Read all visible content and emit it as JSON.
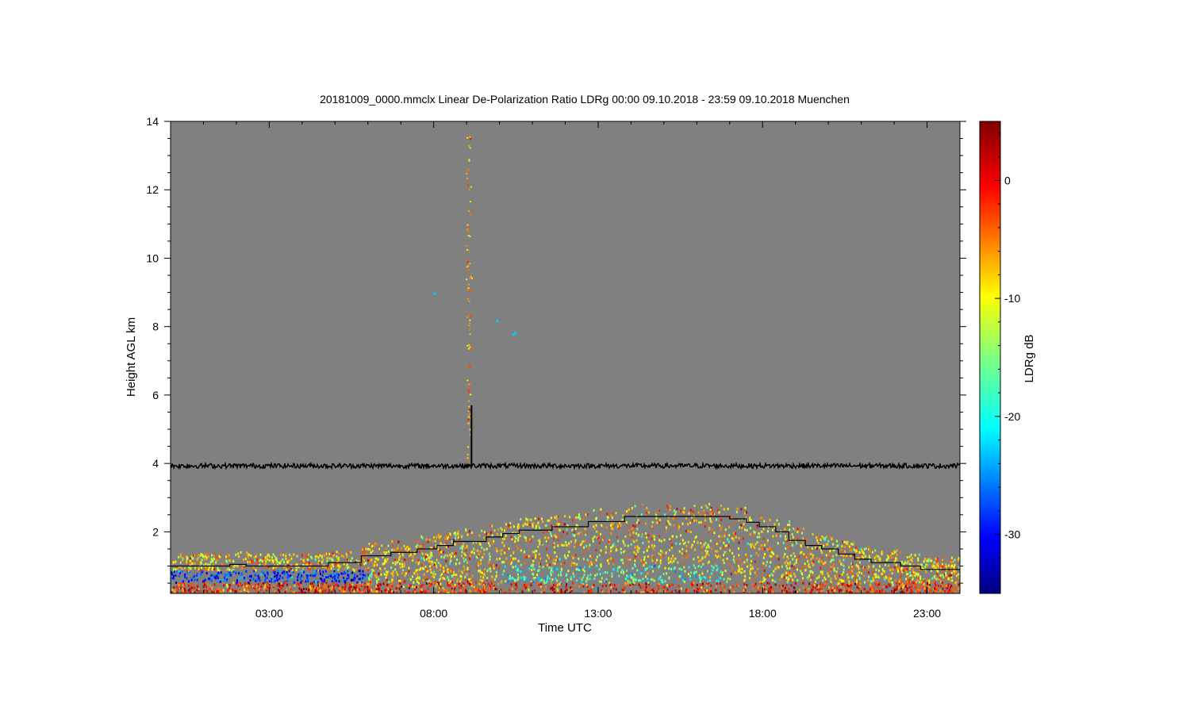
{
  "chart_data": {
    "type": "heatmap",
    "title": "20181009_0000.mmclx Linear De-Polarization Ratio LDRg   00:00 09.10.2018 - 23:59 09.10.2018 Muenchen",
    "xlabel": "Time UTC",
    "ylabel": "Height AGL km",
    "x_ticks": [
      "03:00",
      "08:00",
      "13:00",
      "18:00",
      "23:00"
    ],
    "x_tick_hours": [
      3,
      8,
      13,
      18,
      23
    ],
    "xlim_hours": [
      0,
      24
    ],
    "y_ticks": [
      2,
      4,
      6,
      8,
      10,
      12,
      14
    ],
    "ylim": [
      0.2,
      14
    ],
    "colorbar": {
      "label": "LDRg dB",
      "ticks": [
        0,
        -10,
        -20,
        -30
      ],
      "range": [
        -35,
        5
      ]
    },
    "background_color": "#808080",
    "noise_line_height_km": 3.93,
    "spike": {
      "time_hours": 9.15,
      "top_km": 5.7
    },
    "boundary_layer_steps": [
      [
        0,
        1.0
      ],
      [
        1.8,
        1.05
      ],
      [
        2.3,
        1.0
      ],
      [
        4.8,
        1.1
      ],
      [
        5.8,
        1.3
      ],
      [
        6.7,
        1.4
      ],
      [
        7.5,
        1.5
      ],
      [
        8.1,
        1.6
      ],
      [
        8.6,
        1.72
      ],
      [
        9.6,
        1.85
      ],
      [
        10.1,
        1.95
      ],
      [
        10.6,
        2.05
      ],
      [
        11.6,
        2.15
      ],
      [
        12.7,
        2.3
      ],
      [
        13.8,
        2.45
      ],
      [
        17.0,
        2.38
      ],
      [
        17.5,
        2.28
      ],
      [
        17.9,
        2.15
      ],
      [
        18.4,
        2.0
      ],
      [
        18.8,
        1.75
      ],
      [
        19.3,
        1.6
      ],
      [
        19.8,
        1.5
      ],
      [
        20.3,
        1.35
      ],
      [
        20.8,
        1.2
      ],
      [
        21.3,
        1.1
      ],
      [
        22.2,
        1.0
      ],
      [
        22.8,
        0.9
      ],
      [
        24,
        0.9
      ]
    ]
  }
}
